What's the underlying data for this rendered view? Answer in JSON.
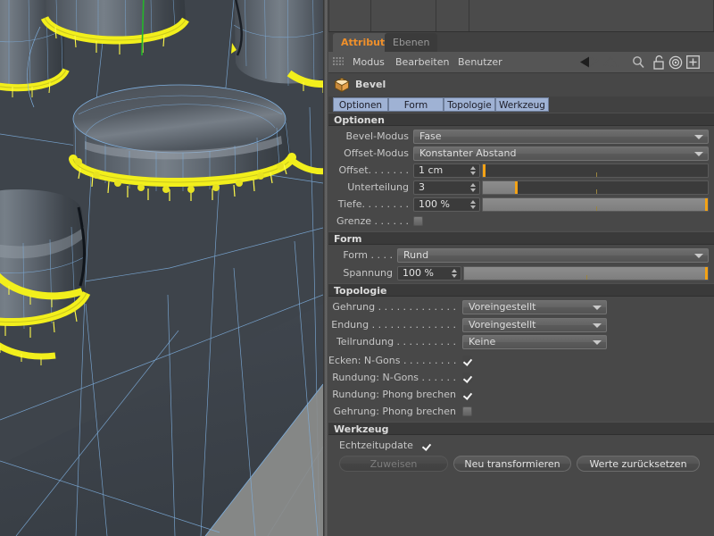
{
  "dock": {
    "tabs": [
      {
        "label": "Attribute",
        "active": true
      },
      {
        "label": "Ebenen",
        "active": false
      }
    ]
  },
  "menubar": {
    "grid_icon": "grid-icon",
    "items": [
      "Modus",
      "Bearbeiten",
      "Benutzer"
    ],
    "icons": [
      "back-arrow-icon",
      "forward-arrow-icon",
      "search-icon",
      "lock-icon",
      "target-icon",
      "plus-icon"
    ]
  },
  "object": {
    "icon": "bevel-object-icon",
    "name": "Bevel"
  },
  "attribute_tabs": [
    {
      "label": "Optionen"
    },
    {
      "label": "Form"
    },
    {
      "label": "Topologie"
    },
    {
      "label": "Werkzeug"
    }
  ],
  "sections": {
    "optionen": {
      "title": "Optionen",
      "bevel_modus": {
        "label": "Bevel-Modus",
        "value": "Fase"
      },
      "offset_modus": {
        "label": "Offset-Modus",
        "value": "Konstanter Abstand"
      },
      "offset": {
        "label": "Offset. . . . . . .",
        "value": "1 cm",
        "fill_pct": 0,
        "knob_pct": 0
      },
      "unterteilung": {
        "label": "Unterteilung",
        "value": "3",
        "fill_pct": 15,
        "knob_pct": 15
      },
      "tiefe": {
        "label": "Tiefe. . . . . . . .",
        "value": "100 %",
        "fill_pct": 100,
        "knob_pct": 100
      },
      "grenze": {
        "label": "Grenze . . . . . .",
        "checked": false
      }
    },
    "form": {
      "title": "Form",
      "form": {
        "label": "Form  . . . .",
        "value": "Rund"
      },
      "spannung": {
        "label": "Spannung",
        "value": "100 %",
        "fill_pct": 100,
        "knob_pct": 100
      }
    },
    "topologie": {
      "title": "Topologie",
      "gehrung": {
        "label": "Gehrung . . . . . . . . . . . . .",
        "value": "Voreingestellt"
      },
      "endung": {
        "label": "Endung . . . . . . . . . . . . . .",
        "value": "Voreingestellt"
      },
      "teilrundung": {
        "label": "Teilrundung . . . . . . . . . .",
        "value": "Keine"
      },
      "ecken_ngons": {
        "label": "Ecken: N-Gons . . . . . . . . .",
        "checked": true
      },
      "rundung_ngons": {
        "label": "Rundung: N-Gons . . . . . .",
        "checked": true
      },
      "rundung_phong": {
        "label": "Rundung: Phong brechen",
        "checked": true
      },
      "gehrung_phong": {
        "label": "Gehrung: Phong brechen",
        "checked": false
      }
    },
    "werkzeug": {
      "title": "Werkzeug",
      "echtzeitupdate": {
        "label": "Echtzeitupdate",
        "checked": true
      },
      "buttons": [
        {
          "label": "Zuweisen",
          "disabled": true
        },
        {
          "label": "Neu transformieren",
          "disabled": false
        },
        {
          "label": "Werte zurücksetzen",
          "disabled": false
        }
      ]
    }
  },
  "viewport": {
    "name": "3d-viewport",
    "background_color": "#3e444b",
    "wireframe_color": "#7fb0e0",
    "selection_color": "#f2ef1c",
    "axis_color": "#25b52a"
  },
  "colors": {
    "panel_bg": "#484848",
    "section_header_bg": "#3a3a3a",
    "tab_active_text": "#f0902a",
    "attr_tab_bg": "#9fb2d4",
    "slider_knob": "#f3a215"
  }
}
